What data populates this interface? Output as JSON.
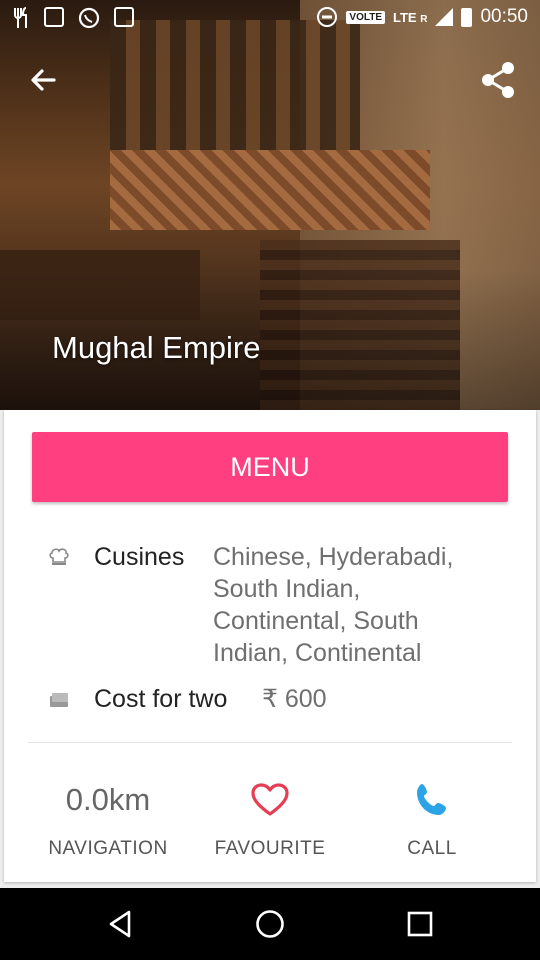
{
  "status_bar": {
    "volte": "VOLTE",
    "lte": "LTE",
    "roaming": "R",
    "time": "00:50"
  },
  "restaurant": {
    "name": "Mughal Empire"
  },
  "menu_button": "MENU",
  "details": {
    "cuisines_label": "Cusines",
    "cuisines_value": [
      "Chinese, Hyderabadi,",
      "South Indian,",
      "Continental, South",
      "Indian, Continental"
    ],
    "cost_label": "Cost for two",
    "cost_value": "₹ 600"
  },
  "actions": {
    "distance": "0.0km",
    "navigation_label": "NAVIGATION",
    "favourite_label": "FAVOURITE",
    "call_label": "CALL"
  },
  "colors": {
    "accent": "#ff3f7f",
    "heart": "#e63e55",
    "call": "#2ba3e6"
  },
  "icons": [
    "back-arrow-icon",
    "share-icon",
    "chef-hat-icon",
    "card-icon",
    "heart-icon",
    "phone-icon",
    "nav-back-icon",
    "nav-home-icon",
    "nav-recents-icon"
  ]
}
